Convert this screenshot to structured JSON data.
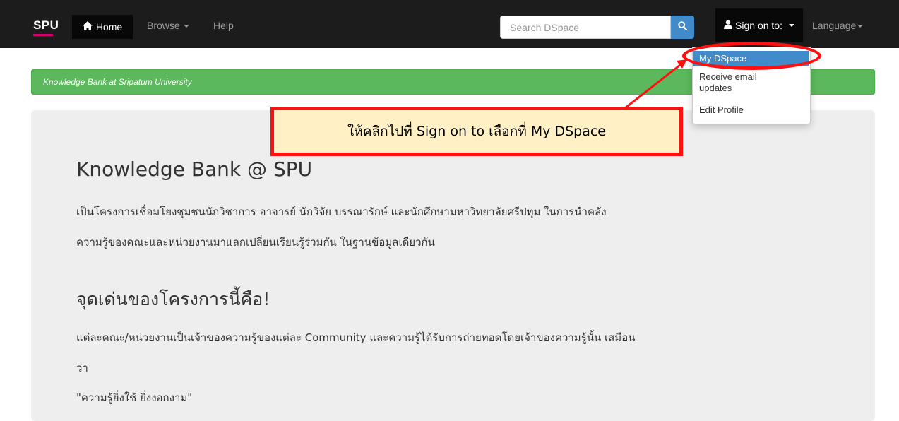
{
  "navbar": {
    "brand": "SPU",
    "home_label": "Home",
    "browse_label": "Browse",
    "help_label": "Help",
    "search_placeholder": "Search DSpace",
    "signon_label": "Sign on to:",
    "language_label": "Language"
  },
  "dropdown": {
    "items": [
      "My DSpace",
      "Receive email updates",
      "Edit Profile"
    ],
    "item_lines": [
      "Receive email",
      "updates"
    ]
  },
  "banner": {
    "text": "Knowledge Bank at Sripatum University"
  },
  "main": {
    "title": "Knowledge Bank @ SPU",
    "intro_line1": "เป็นโครงการเชื่อมโยงชุมชนนักวิชาการ อาจารย์ นักวิจัย บรรณารักษ์ และนักศึกษามหาวิทยาลัยศรีปทุม ในการนำคลัง",
    "intro_line2": "ความรู้ของคณะและหน่วยงานมาแลกเปลี่ยนเรียนรู้ร่วมกัน ในฐานข้อมูลเดียวกัน",
    "highlight_title": "จุดเด่นของโครงการนี้คือ!",
    "highlight_line1": "แต่ละคณะ/หน่วยงานเป็นเจ้าของความรู้ของแต่ละ Community และความรู้ได้รับการถ่ายทอดโดยเจ้าของความรู้นั้น เสมือน",
    "highlight_line2": "ว่า",
    "quote": "\"ความรู้ยิ่งใช้ ยิ่งงอกงาม\""
  },
  "annotation": {
    "text": "ให้คลิกไปที่ Sign on to เลือกที่ My DSpace"
  },
  "icons": [
    "home-icon",
    "search-icon",
    "user-icon"
  ],
  "colors": {
    "navbar": "#1c1c1c",
    "accent": "#428bca",
    "banner": "#5cb85c",
    "highlight": "#ff1010"
  }
}
